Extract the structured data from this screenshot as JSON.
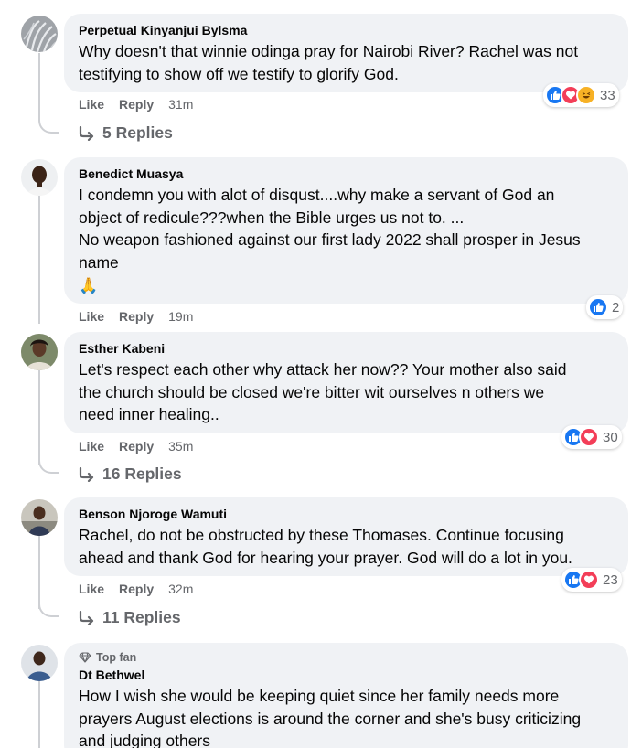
{
  "comments": [
    {
      "author": "Perpetual Kinyanjui Bylsma",
      "text": [
        "Why doesn't that winnie odinga pray for Nairobi River? Rachel was not",
        "testifying to show off we testify to glorify God."
      ],
      "like_label": "Like",
      "reply_label": "Reply",
      "time": "31m",
      "reaction_types": [
        "like",
        "love",
        "haha"
      ],
      "reaction_count": "33",
      "replies_label": "5 Replies"
    },
    {
      "author": "Benedict Muasya",
      "text": [
        "I condemn you with alot of disqust....why make a servant of God an",
        "object of redicule???when the Bible urges us not to. ...",
        "No weapon fashioned against our first lady 2022 shall prosper in Jesus",
        "name"
      ],
      "emoji": "🙏",
      "like_label": "Like",
      "reply_label": "Reply",
      "time": "19m",
      "reaction_types": [
        "like"
      ],
      "reaction_count": "2"
    },
    {
      "author": "Esther Kabeni",
      "text": [
        "Let's respect each other why attack her now?? Your mother also said",
        "the church should be closed we're bitter wit ourselves n others we",
        "need inner healing.."
      ],
      "like_label": "Like",
      "reply_label": "Reply",
      "time": "35m",
      "reaction_types": [
        "like",
        "love"
      ],
      "reaction_count": "30",
      "replies_label": "16 Replies"
    },
    {
      "author": "Benson Njoroge Wamuti",
      "text": [
        "Rachel, do not be obstructed by these Thomases. Continue focusing",
        "ahead and thank God for hearing your prayer. God will do a lot in you."
      ],
      "like_label": "Like",
      "reply_label": "Reply",
      "time": "32m",
      "reaction_types": [
        "like",
        "love"
      ],
      "reaction_count": "23",
      "replies_label": "11 Replies"
    },
    {
      "badge": "Top fan",
      "author": "Dt Bethwel",
      "text": [
        "How I wish she would be keeping quiet since her family needs more",
        "prayers August elections is around the corner and she's busy criticizing",
        "and judging others"
      ]
    }
  ],
  "colors": {
    "bubble": "#f0f2f5",
    "meta_text": "#65676b",
    "like_blue": "#1877f2",
    "love_red": "#f33e58",
    "haha_yellow": "#f7b125"
  },
  "icons": {
    "reply_arrow": "reply-arrow-icon",
    "top_fan": "diamond-icon"
  }
}
